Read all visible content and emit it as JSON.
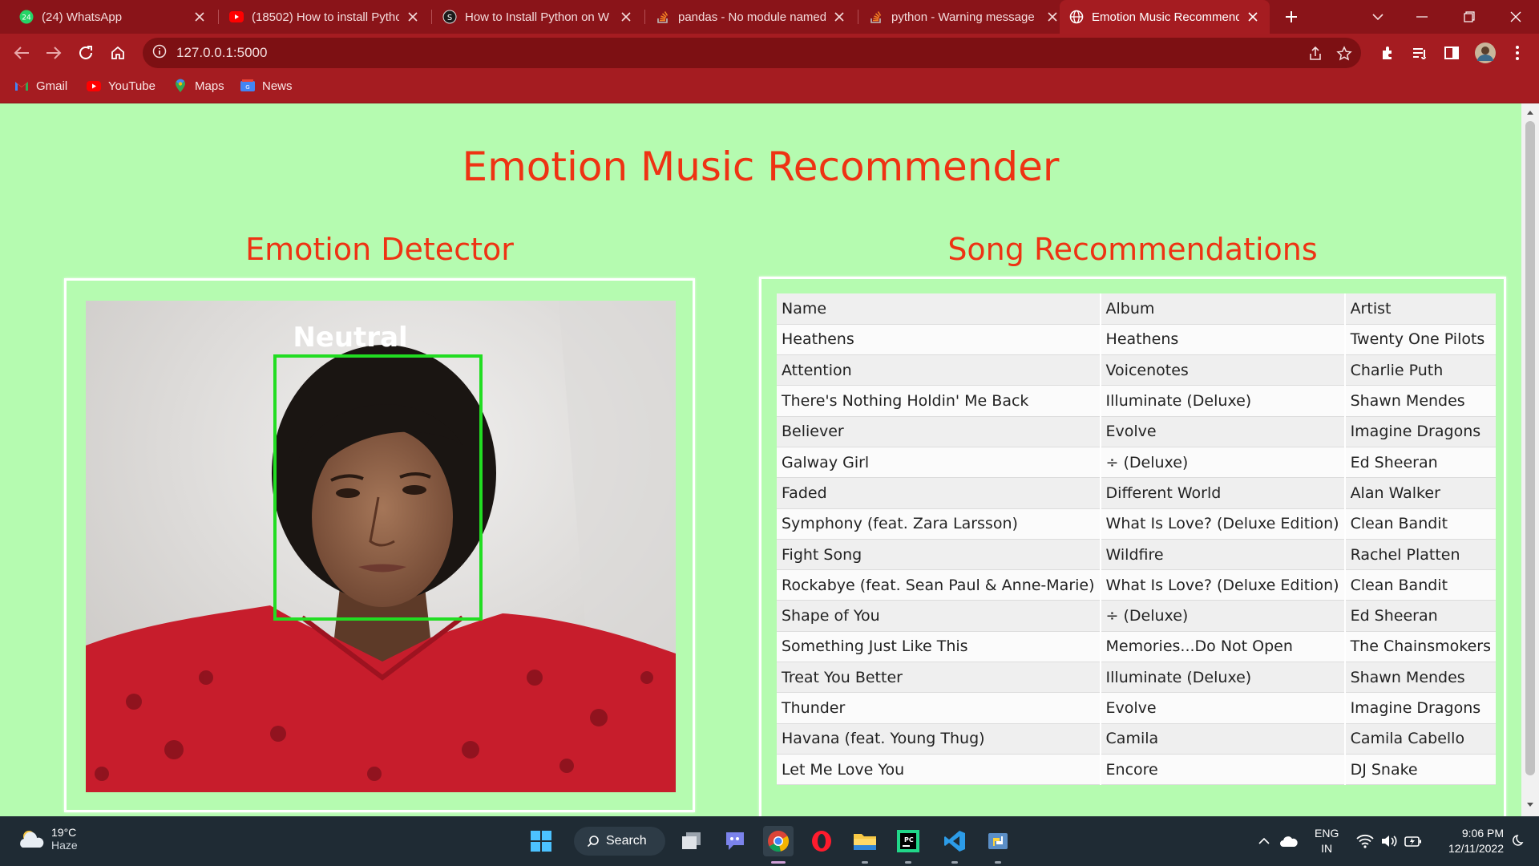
{
  "browser": {
    "tabs": [
      {
        "title": "(24) WhatsApp",
        "icon": "whatsapp-icon"
      },
      {
        "title": "(18502) How to install Pytho",
        "icon": "youtube-icon"
      },
      {
        "title": "How to Install Python on W",
        "icon": "scaler-icon"
      },
      {
        "title": "pandas - No module named",
        "icon": "stackoverflow-icon"
      },
      {
        "title": "python - Warning message",
        "icon": "stackoverflow-icon"
      },
      {
        "title": "Emotion Music Recommende",
        "icon": "globe-icon",
        "active": true
      }
    ],
    "url": "127.0.0.1:5000",
    "bookmarks": [
      "Gmail",
      "YouTube",
      "Maps",
      "News"
    ],
    "whatsapp_badge": "24"
  },
  "page": {
    "title": "Emotion Music Recommender",
    "left_heading": "Emotion Detector",
    "right_heading": "Song Recommendations",
    "detected_emotion": "Neutral",
    "accent_color": "#ee3313",
    "background_color": "#b5fbb0",
    "box_color": "#22dd22"
  },
  "songs": {
    "columns": [
      "Name",
      "Album",
      "Artist"
    ],
    "rows": [
      [
        "Heathens",
        "Heathens",
        "Twenty One Pilots"
      ],
      [
        "Attention",
        "Voicenotes",
        "Charlie Puth"
      ],
      [
        "There's Nothing Holdin' Me Back",
        "Illuminate (Deluxe)",
        "Shawn Mendes"
      ],
      [
        "Believer",
        "Evolve",
        "Imagine Dragons"
      ],
      [
        "Galway Girl",
        "÷ (Deluxe)",
        "Ed Sheeran"
      ],
      [
        "Faded",
        "Different World",
        "Alan Walker"
      ],
      [
        "Symphony (feat. Zara Larsson)",
        "What Is Love? (Deluxe Edition)",
        "Clean Bandit"
      ],
      [
        "Fight Song",
        "Wildfire",
        "Rachel Platten"
      ],
      [
        "Rockabye (feat. Sean Paul & Anne-Marie)",
        "What Is Love? (Deluxe Edition)",
        "Clean Bandit"
      ],
      [
        "Shape of You",
        "÷ (Deluxe)",
        "Ed Sheeran"
      ],
      [
        "Something Just Like This",
        "Memories...Do Not Open",
        "The Chainsmokers"
      ],
      [
        "Treat You Better",
        "Illuminate (Deluxe)",
        "Shawn Mendes"
      ],
      [
        "Thunder",
        "Evolve",
        "Imagine Dragons"
      ],
      [
        "Havana (feat. Young Thug)",
        "Camila",
        "Camila Cabello"
      ],
      [
        "Let Me Love You",
        "Encore",
        "DJ Snake"
      ]
    ]
  },
  "taskbar": {
    "temperature": "19°C",
    "weather": "Haze",
    "search_label": "Search",
    "language": "ENG",
    "region": "IN",
    "time": "9:06 PM",
    "date": "12/11/2022"
  }
}
